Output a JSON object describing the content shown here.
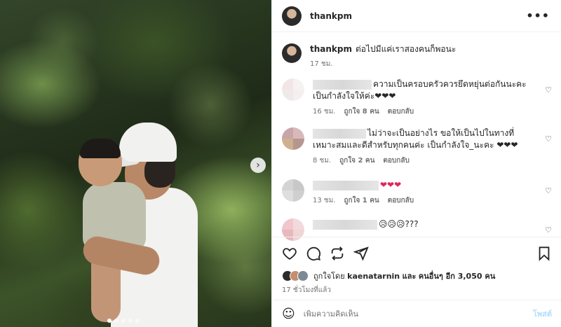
{
  "post": {
    "username": "thankpm",
    "more_icon": "more-dots-icon"
  },
  "caption": {
    "username": "thankpm",
    "text": "ต่อไปมีแค่เราสองคนก็พอนะ",
    "time": "17 ชม."
  },
  "comments": [
    {
      "text": "ความเป็นครอบครัวควรยึดหยุ่นต่อกันนะคะ เป็นกำลังใจให้ค่ะ❤❤❤",
      "time": "16 ชม.",
      "likes": "ถูกใจ 8 คน",
      "reply": "ตอบกลับ"
    },
    {
      "text": "ไม่ว่าจะเป็นอย่างไร ขอให้เป็นไปในทางที่เหมาะสมและดีสำหรับทุกคนค่ะ เป็นกำลังใจ_นะคะ ❤❤❤",
      "time": "8 ชม.",
      "likes": "ถูกใจ 2 คน",
      "reply": "ตอบกลับ"
    },
    {
      "text": "❤❤❤",
      "time": "13 ชม.",
      "likes": "ถูกใจ 1 คน",
      "reply": "ตอบกลับ"
    },
    {
      "text": "😥😥😥???"
    }
  ],
  "likes": {
    "prefix": "ถูกใจโดย",
    "user": "kaenatarnin",
    "middle": "และ",
    "others": "คนอื่นๆ อีก 3,050 คน"
  },
  "posted_time": "17 ชั่วโมงที่แล้ว",
  "add_comment": {
    "placeholder": "เพิ่มความคิดเห็น",
    "post_label": "โพสต์"
  },
  "carousel": {
    "next_label": "›",
    "slide_count": 5,
    "active_slide": 1
  }
}
